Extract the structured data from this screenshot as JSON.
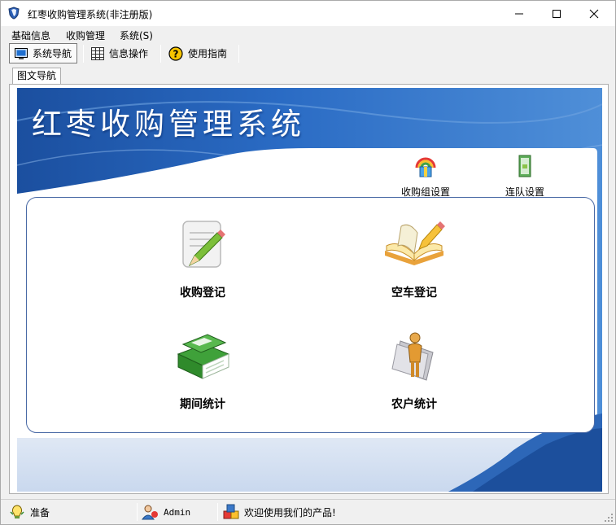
{
  "window": {
    "title": "红枣收购管理系统(非注册版)"
  },
  "menu": [
    "基础信息",
    "收购管理",
    "系统(S)"
  ],
  "toolbar": {
    "nav_label": "系统导航",
    "info_label": "信息操作",
    "guide_label": "使用指南"
  },
  "tabs": [
    "图文导航"
  ],
  "banner": {
    "title": "红枣收购管理系统"
  },
  "shortcuts": {
    "group_setup": "收购组设置",
    "team_setup": "连队设置"
  },
  "modules": {
    "purchase_register": "收购登记",
    "empty_truck_register": "空车登记",
    "period_stats": "期间统计",
    "farmer_stats": "农户统计"
  },
  "status": {
    "ready": "准备",
    "user": "Admin",
    "welcome": "欢迎使用我们的产品!"
  },
  "colors": {
    "banner_blue": "#1c56a9",
    "panel_border": "#4a6aa6",
    "bottom_band": "#d4e0f1"
  }
}
